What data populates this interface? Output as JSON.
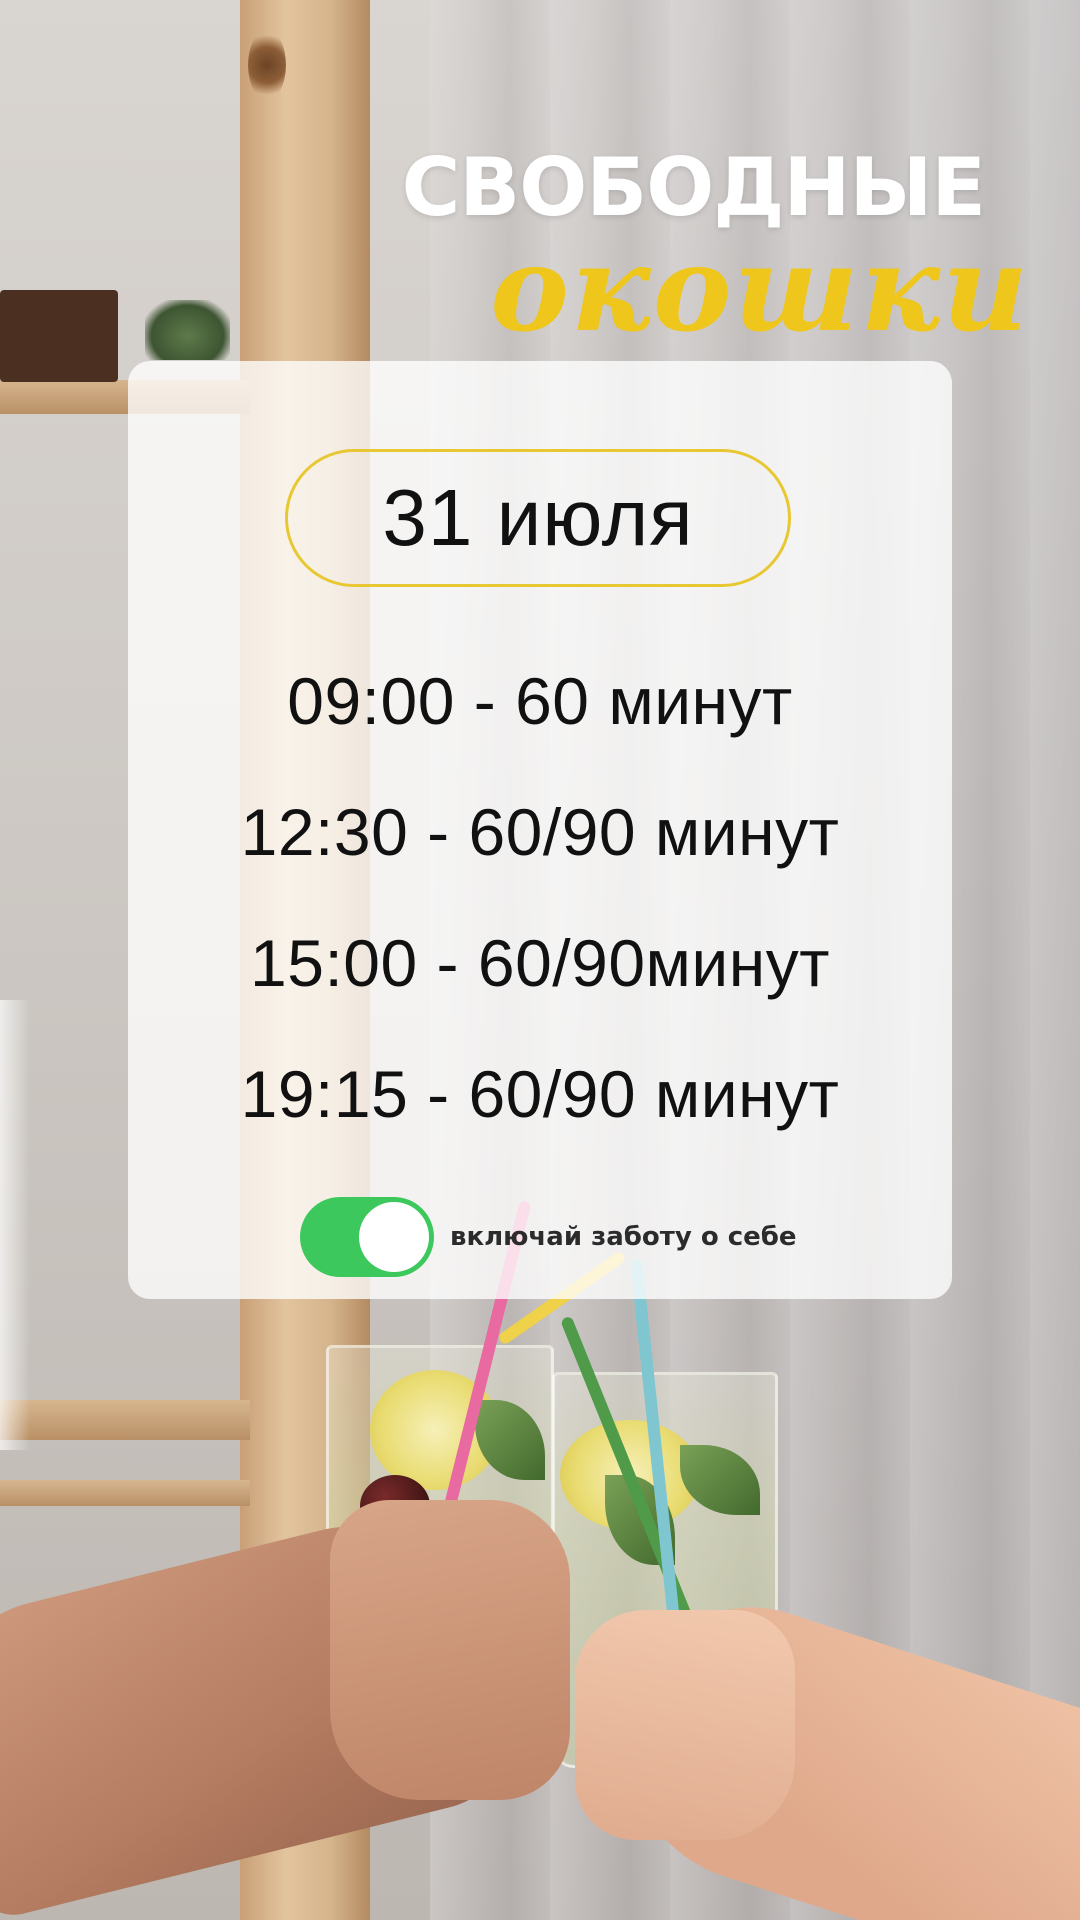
{
  "header": {
    "title_line1": "СВОБОДНЫЕ",
    "title_line2": "окошки"
  },
  "card": {
    "date": "31 июля",
    "slots": [
      "09:00 - 60 минут",
      "12:30 - 60/90 минут",
      "15:00 - 60/90минут",
      "19:15 - 60/90 минут"
    ],
    "toggle": {
      "state": "on",
      "label": "включай заботу о себе"
    }
  },
  "colors": {
    "accent_yellow": "#efc61c",
    "toggle_green": "#3cc85d",
    "text_dark": "#111111",
    "title_white": "#ffffff"
  }
}
